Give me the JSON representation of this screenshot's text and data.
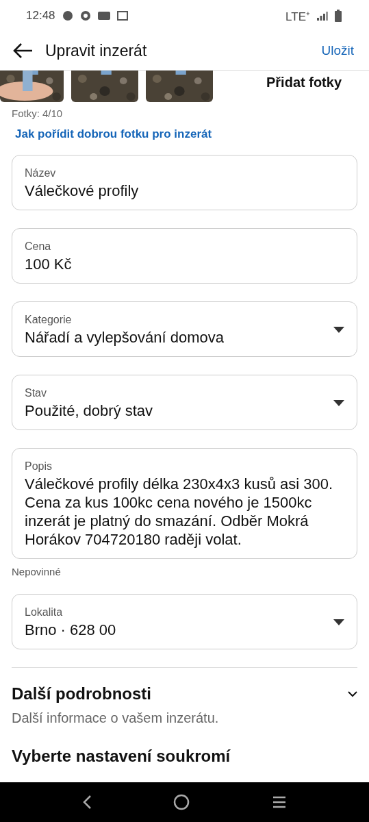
{
  "status_bar": {
    "time": "12:48",
    "network": "LTE⁺"
  },
  "header": {
    "title": "Upravit inzerát",
    "action": "Uložit"
  },
  "photos": {
    "add_label": "Přidat fotky",
    "count": "Fotky: 4/10",
    "help_link": "Jak pořídit dobrou fotku pro inzerát"
  },
  "fields": [
    {
      "kind": "text",
      "label": "Název",
      "value": "Válečkové profily"
    },
    {
      "kind": "text",
      "label": "Cena",
      "value": "100 Kč"
    },
    {
      "kind": "dropdown",
      "label": "Kategorie",
      "value": "Nářadí a vylepšování domova"
    },
    {
      "kind": "dropdown",
      "label": "Stav",
      "value": "Použité, dobrý stav"
    },
    {
      "kind": "textarea",
      "label": "Popis",
      "value": "Válečkové profily délka 230x4x3 kusů asi 300. Cena za kus 100kc cena nového je 1500kc inzerát je platný do smazání. Odběr Mokrá Horákov 704720180 raději volat.",
      "hint": "Nepovinné"
    },
    {
      "kind": "dropdown",
      "label": "Lokalita",
      "value": "Brno · 628 00"
    }
  ],
  "details": {
    "title": "Další podrobnosti",
    "subtitle": "Další informace o vašem inzerátu."
  },
  "next_section": {
    "title": "Vyberte nastavení soukromí"
  }
}
